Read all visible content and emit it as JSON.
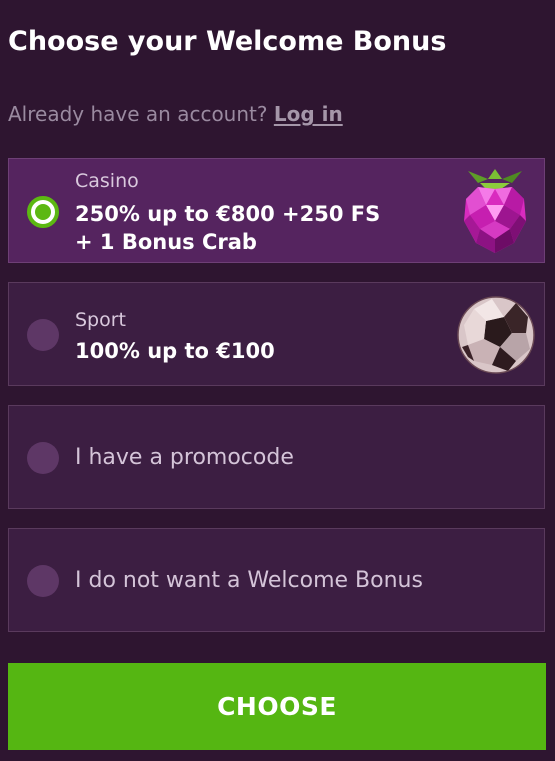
{
  "header": {
    "title": "Choose your Welcome Bonus",
    "account_prompt": "Already have an account?",
    "login_label": "Log in"
  },
  "options": [
    {
      "label": "Casino",
      "offer_line1": "250% up to €800 +250 FS",
      "offer_line2": "+ 1 Bonus Crab",
      "selected": true,
      "icon": "raspberry-gem-icon"
    },
    {
      "label": "Sport",
      "offer_line1": "100% up to €100",
      "selected": false,
      "icon": "soccer-ball-icon"
    },
    {
      "label": "I have a promocode",
      "selected": false
    },
    {
      "label": "I do not want a Welcome Bonus",
      "selected": false
    }
  ],
  "actions": {
    "choose_label": "CHOOSE"
  },
  "colors": {
    "background": "#2e1530",
    "card": "#3c1e42",
    "card_selected": "#55245f",
    "accent_green": "#55b612",
    "radio_off": "#5e3766"
  }
}
